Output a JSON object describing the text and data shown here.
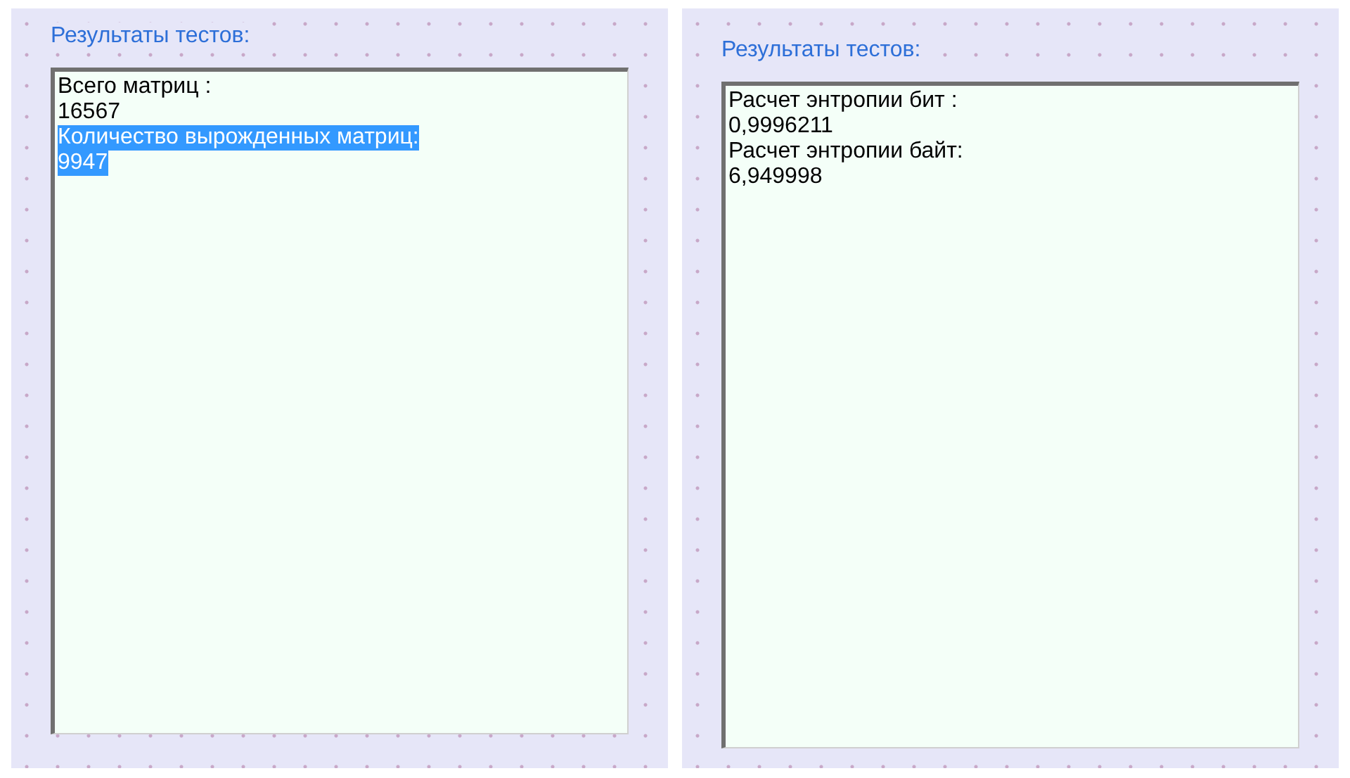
{
  "panels": [
    {
      "label": "Результаты тестов:",
      "lines": [
        {
          "text": "Всего матриц :",
          "selected": false
        },
        {
          "text": "16567",
          "selected": false
        },
        {
          "text": "Количество вырожденных матриц:",
          "selected": true
        },
        {
          "text": "9947",
          "selected": true
        }
      ]
    },
    {
      "label": "Результаты тестов:",
      "lines": [
        {
          "text": "Расчет энтропии бит :",
          "selected": false
        },
        {
          "text": "0,9996211",
          "selected": false
        },
        {
          "text": "Расчет энтропии байт:",
          "selected": false
        },
        {
          "text": "6,949998",
          "selected": false
        }
      ]
    }
  ]
}
